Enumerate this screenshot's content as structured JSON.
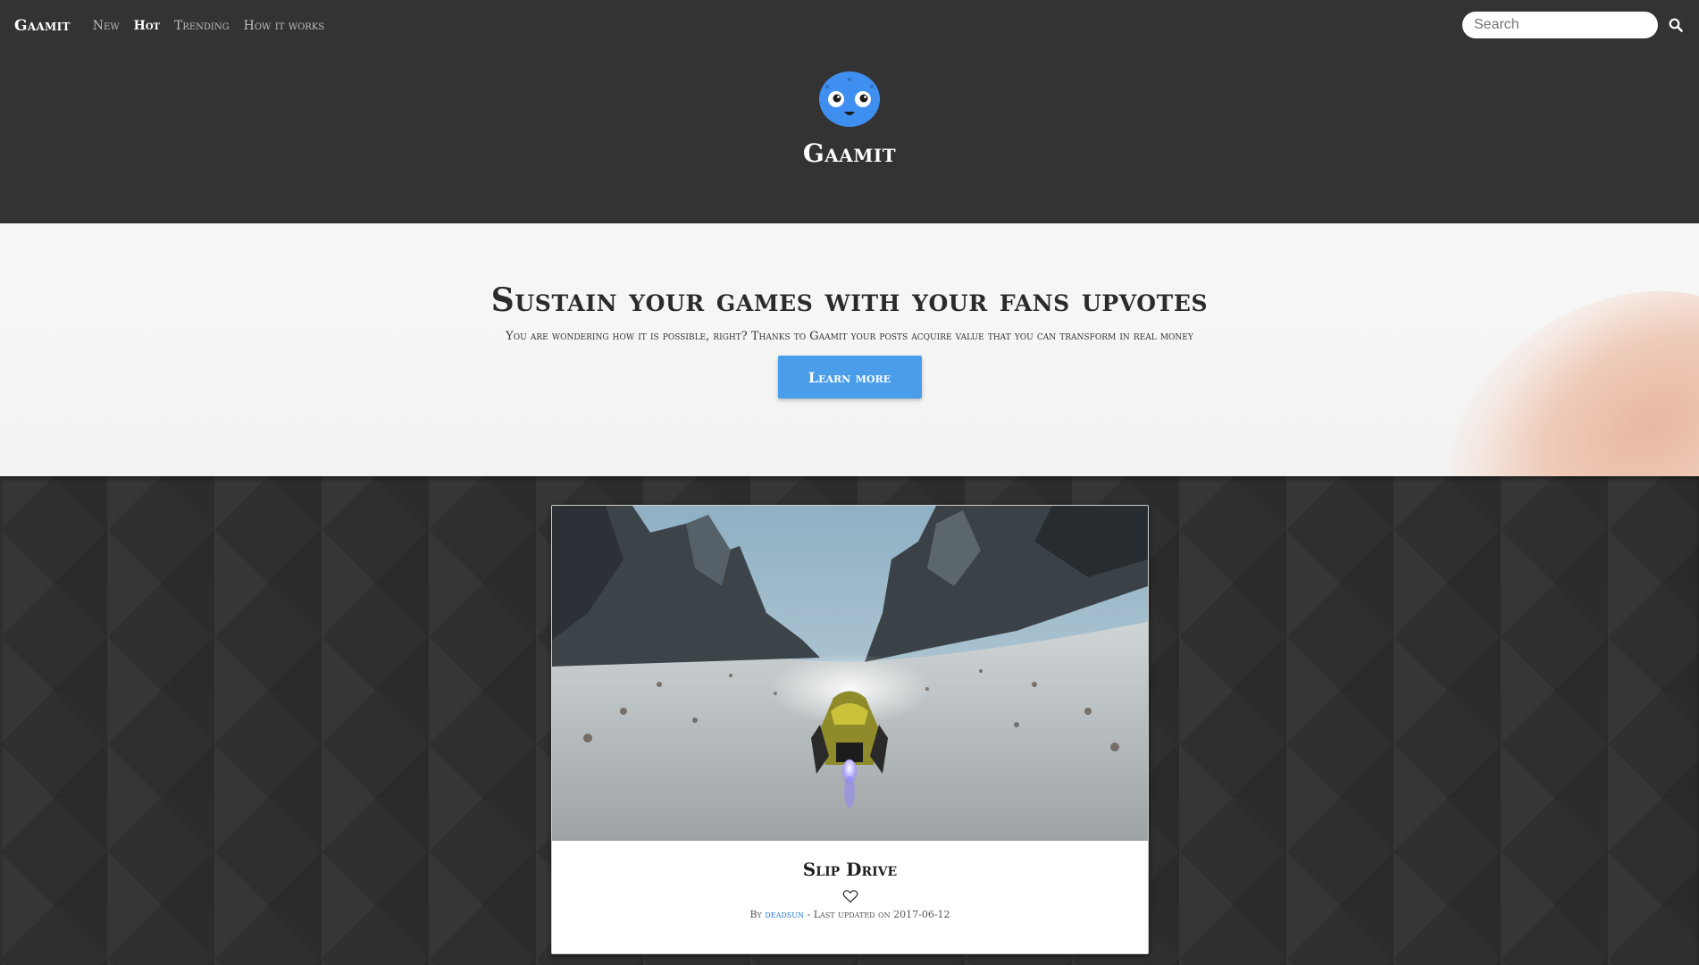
{
  "navbar": {
    "brand": "Gaamit",
    "links": [
      {
        "label": "New"
      },
      {
        "label": "Hot"
      },
      {
        "label": "Trending"
      },
      {
        "label": "How it works"
      }
    ],
    "active_link": "Hot",
    "search": {
      "placeholder": "Search",
      "value": "",
      "icon": "search-icon"
    }
  },
  "header": {
    "logo_icon": "gaamit-mascot-logo",
    "title": "Gaamit"
  },
  "hero": {
    "title": "Sustain your games with your fans upvotes",
    "subtitle": "You are wondering how it is possible, right? Thanks to Gaamit your posts acquire value that you can transform in real money",
    "button_label": "Learn more"
  },
  "post": {
    "image_alt": "Futuristic hover racer speeding through a snowy canyon",
    "title": "Slip Drive",
    "heart_icon": "heart-icon",
    "by_label": "By",
    "author": "deadsun",
    "separator": "-",
    "updated_label": "Last updated on",
    "updated_date": "2017-06-12"
  },
  "colors": {
    "background": "#333333",
    "accent": "#4a9ee9",
    "link": "#2a7ad6",
    "logo_blue": "#3f8ff0"
  }
}
